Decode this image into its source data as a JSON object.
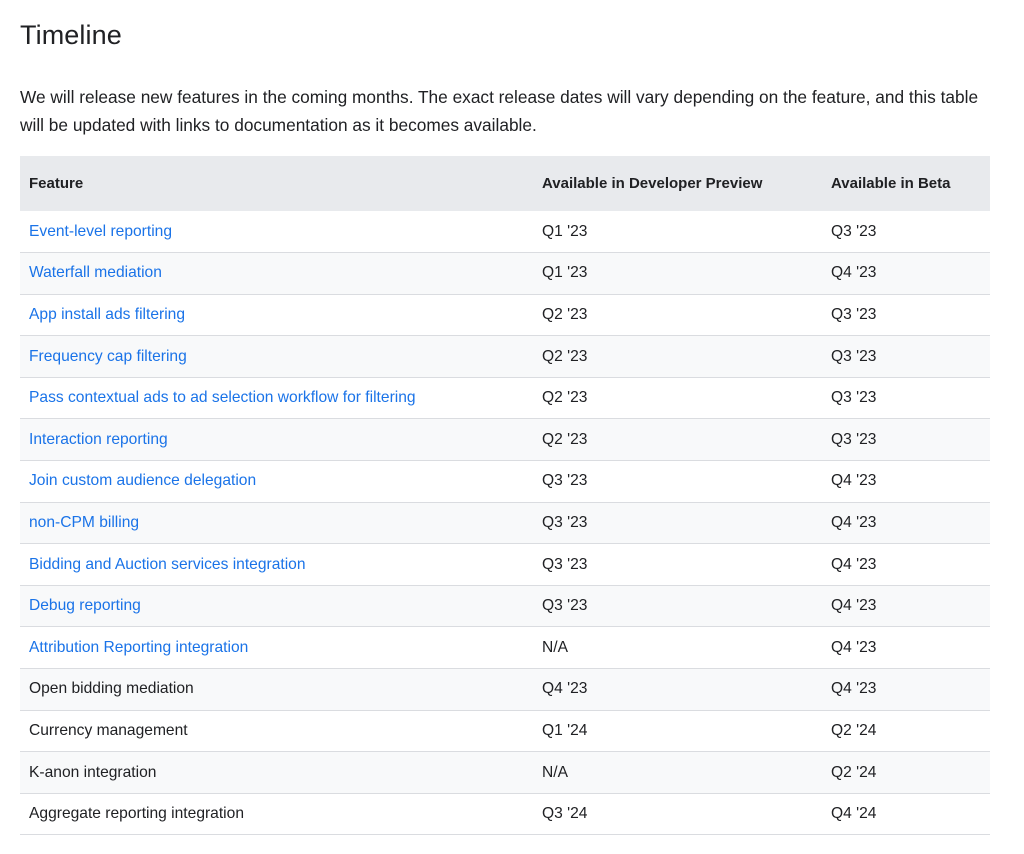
{
  "title": "Timeline",
  "intro": "We will release new features in the coming months. The exact release dates will vary depending on the feature, and this table will be updated with links to documentation as it becomes available.",
  "table": {
    "headers": [
      "Feature",
      "Available in Developer Preview",
      "Available in Beta"
    ],
    "rows": [
      {
        "feature": "Event-level reporting",
        "link": true,
        "preview": "Q1 '23",
        "beta": "Q3 '23"
      },
      {
        "feature": "Waterfall mediation",
        "link": true,
        "preview": "Q1 '23",
        "beta": "Q4 '23"
      },
      {
        "feature": "App install ads filtering",
        "link": true,
        "preview": "Q2 '23",
        "beta": "Q3 '23"
      },
      {
        "feature": "Frequency cap filtering",
        "link": true,
        "preview": "Q2 '23",
        "beta": "Q3 '23"
      },
      {
        "feature": "Pass contextual ads to ad selection workflow for filtering",
        "link": true,
        "preview": "Q2 '23",
        "beta": "Q3 '23"
      },
      {
        "feature": "Interaction reporting",
        "link": true,
        "preview": "Q2 '23",
        "beta": "Q3 '23"
      },
      {
        "feature": "Join custom audience delegation",
        "link": true,
        "preview": "Q3 '23",
        "beta": "Q4 '23"
      },
      {
        "feature": "non-CPM billing",
        "link": true,
        "preview": "Q3 '23",
        "beta": "Q4 '23"
      },
      {
        "feature": "Bidding and Auction services integration",
        "link": true,
        "preview": "Q3 '23",
        "beta": "Q4 '23"
      },
      {
        "feature": "Debug reporting",
        "link": true,
        "preview": "Q3 '23",
        "beta": "Q4 '23"
      },
      {
        "feature": "Attribution Reporting integration",
        "link": true,
        "preview": "N/A",
        "beta": "Q4 '23"
      },
      {
        "feature": "Open bidding mediation",
        "link": false,
        "preview": "Q4 '23",
        "beta": "Q4 '23"
      },
      {
        "feature": "Currency management",
        "link": false,
        "preview": "Q1 '24",
        "beta": "Q2 '24"
      },
      {
        "feature": "K-anon integration",
        "link": false,
        "preview": "N/A",
        "beta": "Q2 '24"
      },
      {
        "feature": "Aggregate reporting integration",
        "link": false,
        "preview": "Q3 '24",
        "beta": "Q4 '24"
      }
    ]
  },
  "colors": {
    "link": "#1a73e8",
    "text": "#202124",
    "header_bg": "#e8eaed",
    "row_alt_bg": "#f8f9fa",
    "divider": "#dadce0"
  }
}
